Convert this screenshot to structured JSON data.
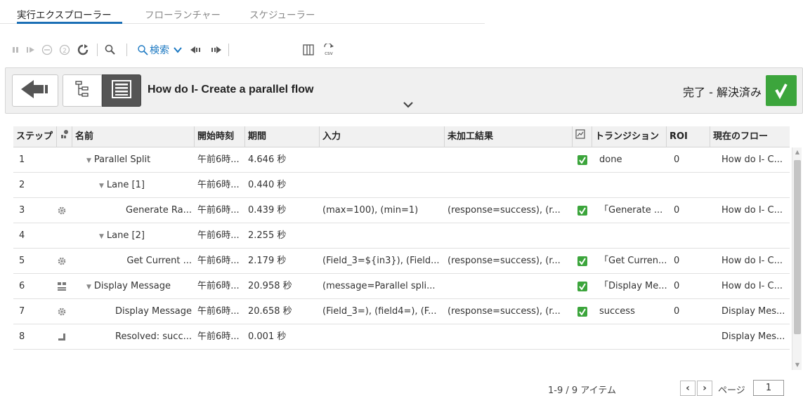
{
  "tabs": [
    {
      "label": "実行エクスプローラー",
      "active": true
    },
    {
      "label": "フローランチャー",
      "active": false
    },
    {
      "label": "スケジューラー",
      "active": false
    }
  ],
  "toolbar": {
    "search_label": "検索",
    "icons": [
      "pause-icon",
      "resume-icon",
      "cancel-icon",
      "step-icon",
      "refresh-icon",
      "zoom-icon",
      "search-icon",
      "prev-icon",
      "next-icon",
      "columns-icon",
      "csv-export-icon"
    ]
  },
  "header": {
    "title": "How do I- Create a parallel flow",
    "status": "完了 - 解決済み",
    "status_color": "#3ca53c"
  },
  "table": {
    "columns": [
      "ステップ",
      "",
      "名前",
      "開始時刻",
      "期間",
      "入力",
      "未加工結果",
      "",
      "トランジション",
      "ROI",
      "現在のフロー"
    ],
    "rows": [
      {
        "step": "1",
        "icon": "",
        "name": "Parallel Split",
        "expander": "▼",
        "indent": 1,
        "start": "午前6時...",
        "duration": "4.646 秒",
        "input": "",
        "raw": "",
        "check": true,
        "transition": "done",
        "roi": "0",
        "flow": "How do I- C..."
      },
      {
        "step": "2",
        "icon": "",
        "name": "Lane [1]",
        "expander": "▼",
        "indent": 2,
        "start": "午前6時...",
        "duration": "0.440 秒",
        "input": "",
        "raw": "",
        "check": false,
        "transition": "",
        "roi": "",
        "flow": ""
      },
      {
        "step": "3",
        "icon": "gear-icon",
        "name": "Generate Ra...",
        "expander": "",
        "indent": 3,
        "start": "午前6時...",
        "duration": "0.439 秒",
        "input": "(max=100), (min=1)",
        "raw": "(response=success), (r...",
        "check": true,
        "transition": "「Generate ...",
        "roi": "0",
        "flow": "How do I- C..."
      },
      {
        "step": "4",
        "icon": "",
        "name": "Lane [2]",
        "expander": "▼",
        "indent": 2,
        "start": "午前6時...",
        "duration": "2.255 秒",
        "input": "",
        "raw": "",
        "check": false,
        "transition": "",
        "roi": "",
        "flow": ""
      },
      {
        "step": "5",
        "icon": "gear-icon",
        "name": "Get Current ...",
        "expander": "",
        "indent": 3,
        "start": "午前6時...",
        "duration": "2.179 秒",
        "input": "(Field_3=${in3}), (Field...",
        "raw": "(response=success), (r...",
        "check": true,
        "transition": "「Get Curren...",
        "roi": "0",
        "flow": "How do I- C..."
      },
      {
        "step": "6",
        "icon": "subflow-icon",
        "name": "Display Message",
        "expander": "▼",
        "indent": 1,
        "start": "午前6時...",
        "duration": "20.958 秒",
        "input": "(message=Parallel spli...",
        "raw": "",
        "check": true,
        "transition": "「Display Me...",
        "roi": "0",
        "flow": "How do I- C..."
      },
      {
        "step": "7",
        "icon": "gear-icon",
        "name": "Display Message",
        "expander": "",
        "indent": 3,
        "start": "午前6時...",
        "duration": "20.658 秒",
        "input": "(Field_3=), (field4=), (F...",
        "raw": "(response=success), (r...",
        "check": true,
        "transition": "success",
        "roi": "0",
        "flow": "Display Mes..."
      },
      {
        "step": "8",
        "icon": "resolved-icon",
        "name": "Resolved: succ...",
        "expander": "",
        "indent": 3,
        "start": "午前6時...",
        "duration": "0.001 秒",
        "input": "",
        "raw": "",
        "check": false,
        "transition": "",
        "roi": "",
        "flow": "Display Mes..."
      }
    ]
  },
  "pager": {
    "count": "1-9 / 9 アイテム",
    "page_label": "ページ",
    "page_value": "1"
  }
}
